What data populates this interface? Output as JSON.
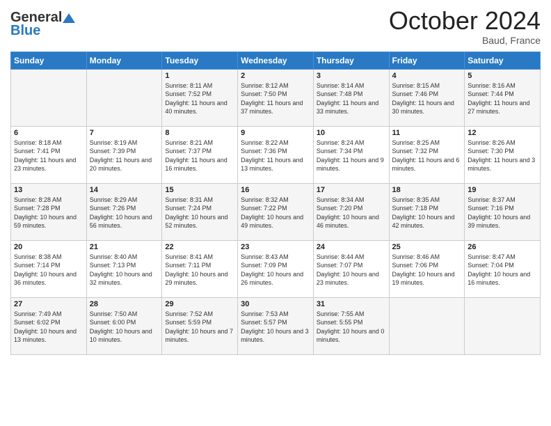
{
  "header": {
    "logo_general": "General",
    "logo_blue": "Blue",
    "month_title": "October 2024",
    "location": "Baud, France"
  },
  "days_header": [
    "Sunday",
    "Monday",
    "Tuesday",
    "Wednesday",
    "Thursday",
    "Friday",
    "Saturday"
  ],
  "weeks": [
    [
      {
        "date": "",
        "sunrise": "",
        "sunset": "",
        "daylight": ""
      },
      {
        "date": "",
        "sunrise": "",
        "sunset": "",
        "daylight": ""
      },
      {
        "date": "1",
        "sunrise": "Sunrise: 8:11 AM",
        "sunset": "Sunset: 7:52 PM",
        "daylight": "Daylight: 11 hours and 40 minutes."
      },
      {
        "date": "2",
        "sunrise": "Sunrise: 8:12 AM",
        "sunset": "Sunset: 7:50 PM",
        "daylight": "Daylight: 11 hours and 37 minutes."
      },
      {
        "date": "3",
        "sunrise": "Sunrise: 8:14 AM",
        "sunset": "Sunset: 7:48 PM",
        "daylight": "Daylight: 11 hours and 33 minutes."
      },
      {
        "date": "4",
        "sunrise": "Sunrise: 8:15 AM",
        "sunset": "Sunset: 7:46 PM",
        "daylight": "Daylight: 11 hours and 30 minutes."
      },
      {
        "date": "5",
        "sunrise": "Sunrise: 8:16 AM",
        "sunset": "Sunset: 7:44 PM",
        "daylight": "Daylight: 11 hours and 27 minutes."
      }
    ],
    [
      {
        "date": "6",
        "sunrise": "Sunrise: 8:18 AM",
        "sunset": "Sunset: 7:41 PM",
        "daylight": "Daylight: 11 hours and 23 minutes."
      },
      {
        "date": "7",
        "sunrise": "Sunrise: 8:19 AM",
        "sunset": "Sunset: 7:39 PM",
        "daylight": "Daylight: 11 hours and 20 minutes."
      },
      {
        "date": "8",
        "sunrise": "Sunrise: 8:21 AM",
        "sunset": "Sunset: 7:37 PM",
        "daylight": "Daylight: 11 hours and 16 minutes."
      },
      {
        "date": "9",
        "sunrise": "Sunrise: 8:22 AM",
        "sunset": "Sunset: 7:36 PM",
        "daylight": "Daylight: 11 hours and 13 minutes."
      },
      {
        "date": "10",
        "sunrise": "Sunrise: 8:24 AM",
        "sunset": "Sunset: 7:34 PM",
        "daylight": "Daylight: 11 hours and 9 minutes."
      },
      {
        "date": "11",
        "sunrise": "Sunrise: 8:25 AM",
        "sunset": "Sunset: 7:32 PM",
        "daylight": "Daylight: 11 hours and 6 minutes."
      },
      {
        "date": "12",
        "sunrise": "Sunrise: 8:26 AM",
        "sunset": "Sunset: 7:30 PM",
        "daylight": "Daylight: 11 hours and 3 minutes."
      }
    ],
    [
      {
        "date": "13",
        "sunrise": "Sunrise: 8:28 AM",
        "sunset": "Sunset: 7:28 PM",
        "daylight": "Daylight: 10 hours and 59 minutes."
      },
      {
        "date": "14",
        "sunrise": "Sunrise: 8:29 AM",
        "sunset": "Sunset: 7:26 PM",
        "daylight": "Daylight: 10 hours and 56 minutes."
      },
      {
        "date": "15",
        "sunrise": "Sunrise: 8:31 AM",
        "sunset": "Sunset: 7:24 PM",
        "daylight": "Daylight: 10 hours and 52 minutes."
      },
      {
        "date": "16",
        "sunrise": "Sunrise: 8:32 AM",
        "sunset": "Sunset: 7:22 PM",
        "daylight": "Daylight: 10 hours and 49 minutes."
      },
      {
        "date": "17",
        "sunrise": "Sunrise: 8:34 AM",
        "sunset": "Sunset: 7:20 PM",
        "daylight": "Daylight: 10 hours and 46 minutes."
      },
      {
        "date": "18",
        "sunrise": "Sunrise: 8:35 AM",
        "sunset": "Sunset: 7:18 PM",
        "daylight": "Daylight: 10 hours and 42 minutes."
      },
      {
        "date": "19",
        "sunrise": "Sunrise: 8:37 AM",
        "sunset": "Sunset: 7:16 PM",
        "daylight": "Daylight: 10 hours and 39 minutes."
      }
    ],
    [
      {
        "date": "20",
        "sunrise": "Sunrise: 8:38 AM",
        "sunset": "Sunset: 7:14 PM",
        "daylight": "Daylight: 10 hours and 36 minutes."
      },
      {
        "date": "21",
        "sunrise": "Sunrise: 8:40 AM",
        "sunset": "Sunset: 7:13 PM",
        "daylight": "Daylight: 10 hours and 32 minutes."
      },
      {
        "date": "22",
        "sunrise": "Sunrise: 8:41 AM",
        "sunset": "Sunset: 7:11 PM",
        "daylight": "Daylight: 10 hours and 29 minutes."
      },
      {
        "date": "23",
        "sunrise": "Sunrise: 8:43 AM",
        "sunset": "Sunset: 7:09 PM",
        "daylight": "Daylight: 10 hours and 26 minutes."
      },
      {
        "date": "24",
        "sunrise": "Sunrise: 8:44 AM",
        "sunset": "Sunset: 7:07 PM",
        "daylight": "Daylight: 10 hours and 23 minutes."
      },
      {
        "date": "25",
        "sunrise": "Sunrise: 8:46 AM",
        "sunset": "Sunset: 7:06 PM",
        "daylight": "Daylight: 10 hours and 19 minutes."
      },
      {
        "date": "26",
        "sunrise": "Sunrise: 8:47 AM",
        "sunset": "Sunset: 7:04 PM",
        "daylight": "Daylight: 10 hours and 16 minutes."
      }
    ],
    [
      {
        "date": "27",
        "sunrise": "Sunrise: 7:49 AM",
        "sunset": "Sunset: 6:02 PM",
        "daylight": "Daylight: 10 hours and 13 minutes."
      },
      {
        "date": "28",
        "sunrise": "Sunrise: 7:50 AM",
        "sunset": "Sunset: 6:00 PM",
        "daylight": "Daylight: 10 hours and 10 minutes."
      },
      {
        "date": "29",
        "sunrise": "Sunrise: 7:52 AM",
        "sunset": "Sunset: 5:59 PM",
        "daylight": "Daylight: 10 hours and 7 minutes."
      },
      {
        "date": "30",
        "sunrise": "Sunrise: 7:53 AM",
        "sunset": "Sunset: 5:57 PM",
        "daylight": "Daylight: 10 hours and 3 minutes."
      },
      {
        "date": "31",
        "sunrise": "Sunrise: 7:55 AM",
        "sunset": "Sunset: 5:55 PM",
        "daylight": "Daylight: 10 hours and 0 minutes."
      },
      {
        "date": "",
        "sunrise": "",
        "sunset": "",
        "daylight": ""
      },
      {
        "date": "",
        "sunrise": "",
        "sunset": "",
        "daylight": ""
      }
    ]
  ]
}
